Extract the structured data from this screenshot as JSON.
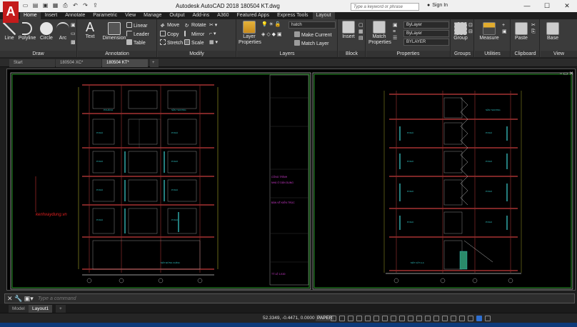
{
  "window": {
    "title": "Autodesk AutoCAD 2018    180504 KT.dwg",
    "search_placeholder": "Type a keyword or phrase",
    "sign_in": "Sign In"
  },
  "tabs": [
    "Home",
    "Insert",
    "Annotate",
    "Parametric",
    "View",
    "Manage",
    "Output",
    "Add-ins",
    "A360",
    "Featured Apps",
    "Express Tools",
    "Layout"
  ],
  "draw": {
    "line": "Line",
    "polyline": "Polyline",
    "circle": "Circle",
    "arc": "Arc",
    "label": "Draw"
  },
  "annotation": {
    "text": "Text",
    "dimension": "Dimension",
    "linear": "Linear",
    "leader": "Leader",
    "table": "Table",
    "label": "Annotation"
  },
  "modify": {
    "move": "Move",
    "rotate": "Rotate",
    "copy": "Copy",
    "mirror": "Mirror",
    "stretch": "Stretch",
    "scale": "Scale",
    "label": "Modify"
  },
  "layers": {
    "props": "Layer Properties",
    "current": "hatch",
    "make_current": "Make Current",
    "match_layer": "Match Layer",
    "label": "Layers"
  },
  "block": {
    "insert": "Insert",
    "label": "Block"
  },
  "properties": {
    "match": "Match Properties",
    "color": "ByLayer",
    "lineweight": "ByLayer",
    "linetype": "BYLAYER",
    "label": "Properties"
  },
  "groups": {
    "group": "Group",
    "label": "Groups"
  },
  "utilities": {
    "measure": "Measure",
    "label": "Utilities"
  },
  "clipboard": {
    "paste": "Paste",
    "label": "Clipboard"
  },
  "view": {
    "base": "Base",
    "label": "View"
  },
  "doc_tabs": [
    "Start",
    "180504 XC*",
    "180504 KT*"
  ],
  "layout_tabs": [
    "Model",
    "Layout1"
  ],
  "drawing": {
    "watermark": "kenhxaydung.vn",
    "left_rooms": [
      "P.KHÁCH",
      "P.NGỦ",
      "P.NGỦ",
      "P.NGỦ",
      "P.NGỦ",
      "P.NGỦ",
      "P.NGỦ",
      "P.NGỦ",
      "P.NGỦ",
      "SÂN THƯỢNG",
      "MẶT ĐỨNG CHÍNH"
    ],
    "right_rooms": [
      "P.NGỦ",
      "P.NGỦ",
      "P.NGỦ",
      "P.NGỦ",
      "P.NGỦ",
      "P.NGỦ",
      "P.NGỦ",
      "P.NGỦ",
      "SÂN THƯỢNG",
      "MẶT CẮT A-A"
    ],
    "title_block": [
      "CÔNG TRÌNH",
      "NHÀ Ở DÂN DỤNG",
      "BẢN VẼ KIẾN TRÚC",
      "TỶ LỆ 1/100"
    ]
  },
  "command": {
    "placeholder": "Type a command"
  },
  "status": {
    "coords": "52.3349, -0.4471, 0.0000",
    "paper": "PAPER"
  }
}
